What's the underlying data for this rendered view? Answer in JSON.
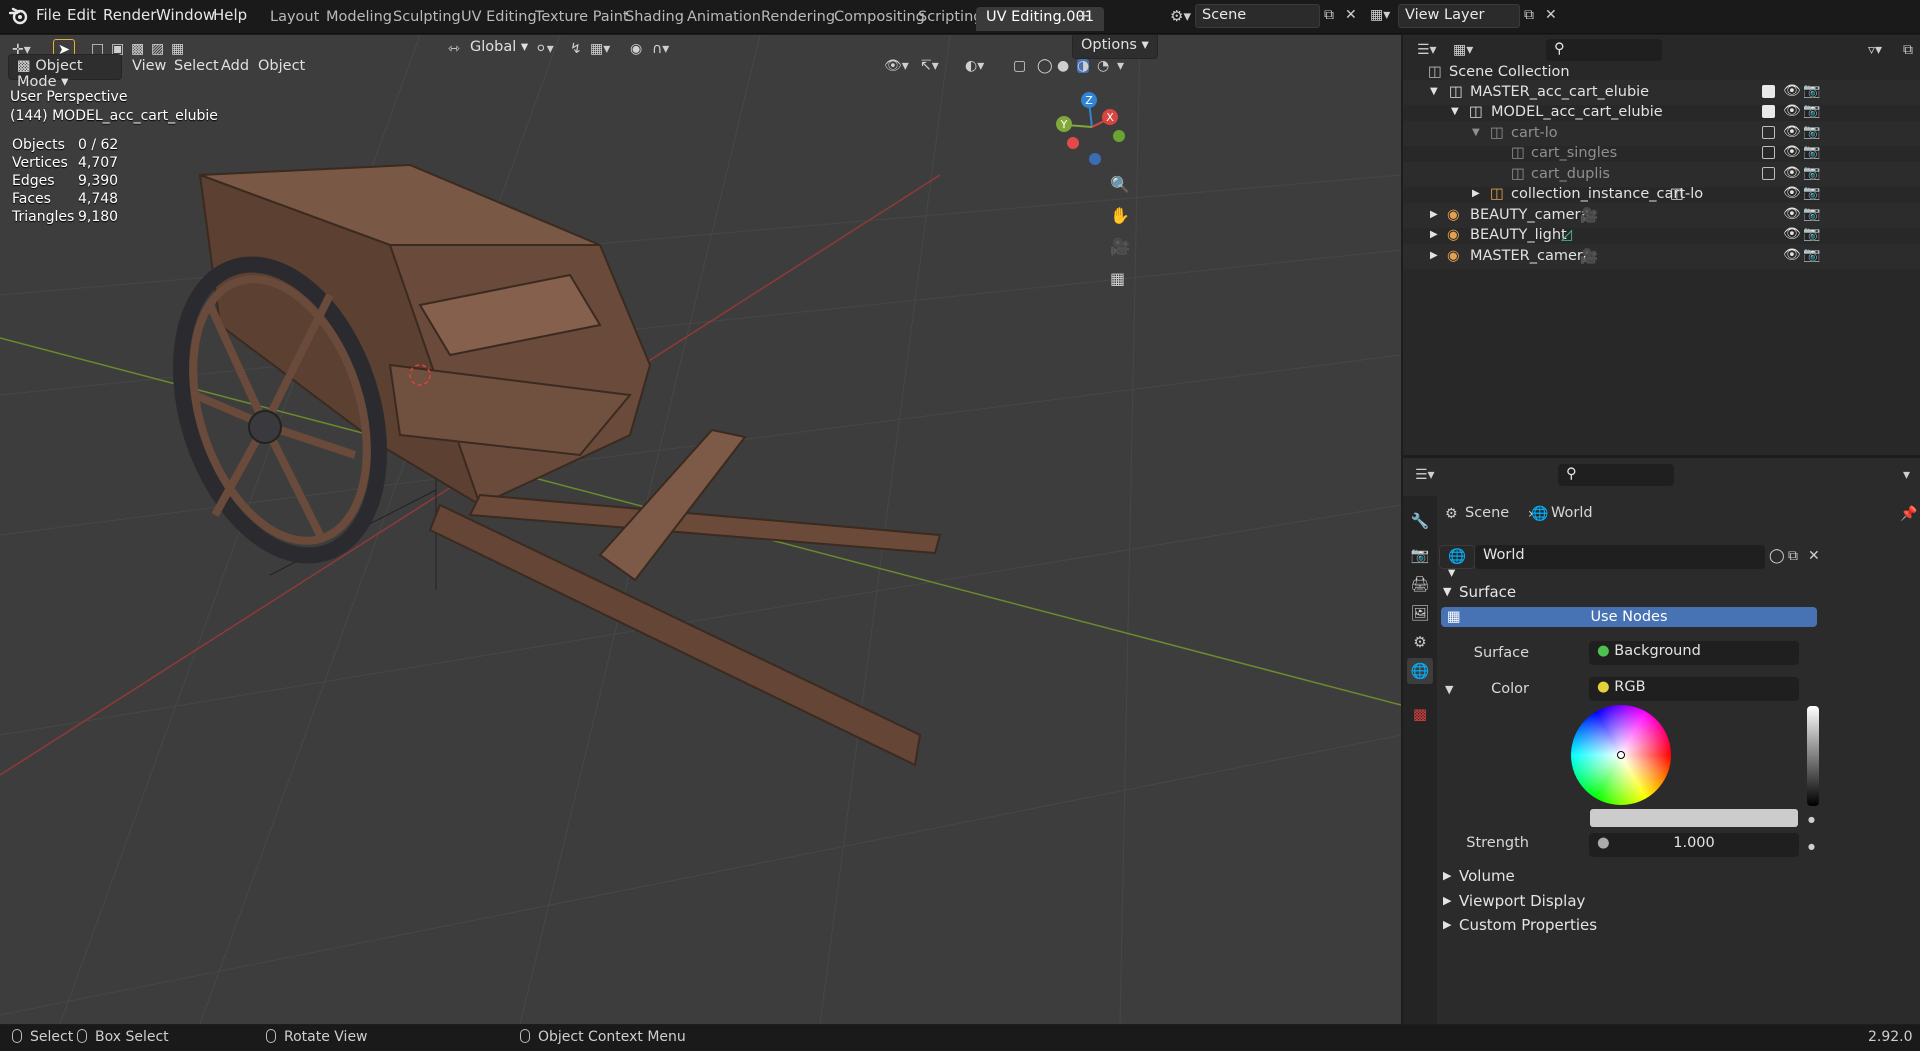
{
  "menu": {
    "items": [
      "File",
      "Edit",
      "Render",
      "Window",
      "Help"
    ]
  },
  "workspaces": [
    "Layout",
    "Modeling",
    "Sculpting",
    "UV Editing",
    "Texture Paint",
    "Shading",
    "Animation",
    "Rendering",
    "Compositing",
    "Scripting",
    "UV Editing.001"
  ],
  "scene": {
    "label": "Scene",
    "view_layer": "View Layer"
  },
  "header": {
    "orientation": "Global",
    "options": "Options"
  },
  "viewport_header": {
    "mode": "Object Mode",
    "menus": [
      "View",
      "Select",
      "Add",
      "Object"
    ]
  },
  "viewport": {
    "perspective": "User Perspective",
    "active_object": "(144) MODEL_acc_cart_elubie",
    "stats": [
      {
        "label": "Objects",
        "value": "0 / 62"
      },
      {
        "label": "Vertices",
        "value": "4,707"
      },
      {
        "label": "Edges",
        "value": "9,390"
      },
      {
        "label": "Faces",
        "value": "4,748"
      },
      {
        "label": "Triangles",
        "value": "9,180"
      }
    ],
    "gizmo": {
      "z": "Z",
      "y": "Y",
      "x": "X"
    }
  },
  "outliner": {
    "root": "Scene Collection",
    "rows": [
      {
        "name": "MASTER_acc_cart_elubie",
        "dim": false
      },
      {
        "name": "MODEL_acc_cart_elubie",
        "dim": false
      },
      {
        "name": "cart-lo",
        "dim": true
      },
      {
        "name": "cart_singles",
        "dim": true
      },
      {
        "name": "cart_duplis",
        "dim": true
      },
      {
        "name": "collection_instance_cart-lo",
        "dim": false
      },
      {
        "name": "BEAUTY_camera",
        "dim": false
      },
      {
        "name": "BEAUTY_light",
        "dim": false
      },
      {
        "name": "MASTER_camera",
        "dim": false
      }
    ]
  },
  "properties": {
    "breadcrumb_scene": "Scene",
    "breadcrumb_world": "World",
    "world_name": "World",
    "surface_panel": "Surface",
    "use_nodes": "Use Nodes",
    "surface_label": "Surface",
    "surface_value": "Background",
    "color_label": "Color",
    "color_value": "RGB",
    "strength_label": "Strength",
    "strength_value": "1.000",
    "panels": [
      "Volume",
      "Viewport Display",
      "Custom Properties"
    ]
  },
  "statusbar": {
    "select": "Select",
    "box_select": "Box Select",
    "rotate": "Rotate View",
    "context": "Object Context Menu",
    "version": "2.92.0"
  },
  "colors": {
    "accent": "#4772b3",
    "active_tab": "#3a3a3a",
    "x_axis": "#d9463f",
    "y_axis": "#80a83a",
    "z_axis": "#2f84d6"
  }
}
